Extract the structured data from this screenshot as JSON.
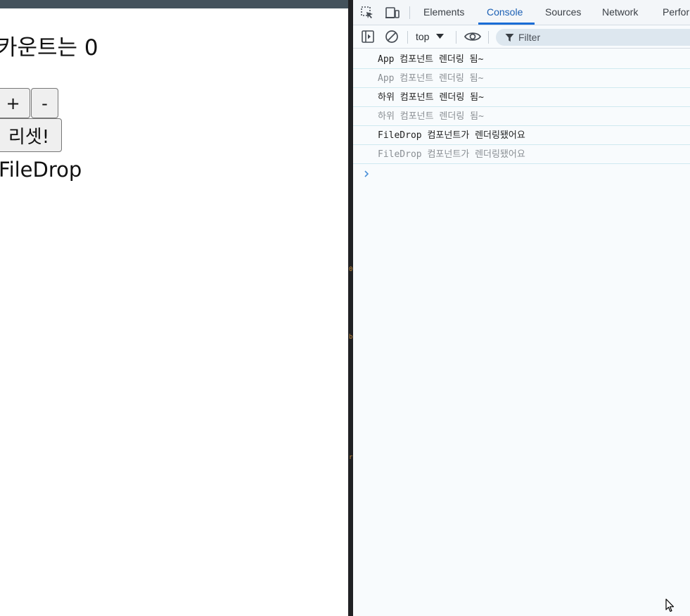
{
  "app": {
    "count_heading": "카운트는 0",
    "plus_label": "+",
    "minus_label": "-",
    "reset_label": "리셋!",
    "filedrop_text": "FileDrop"
  },
  "divider_marks": [
    "0",
    "b",
    "r"
  ],
  "devtools": {
    "tabs": [
      {
        "label": "Elements",
        "active": false
      },
      {
        "label": "Console",
        "active": true
      },
      {
        "label": "Sources",
        "active": false
      },
      {
        "label": "Network",
        "active": false
      },
      {
        "label": "Perfor",
        "active": false
      }
    ],
    "context": "top",
    "filter_placeholder": "Filter",
    "logs": [
      {
        "text": "App 컴포넌트 렌더링 됨~",
        "dim": false
      },
      {
        "text": "App 컴포넌트 렌더링 됨~",
        "dim": true
      },
      {
        "text": "하위 컴포넌트 렌더링 됨~",
        "dim": false
      },
      {
        "text": "하위 컴포넌트 렌더링 됨~",
        "dim": true
      },
      {
        "text": "FileDrop 컴포넌트가 렌더링됐어요",
        "dim": false
      },
      {
        "text": "FileDrop 컴포넌트가 렌더링됐어요",
        "dim": true
      }
    ]
  },
  "colors": {
    "active_tab": "#1a5fb4",
    "tab_underline": "#1a6dd6",
    "prompt_chevron": "#4a90d9"
  },
  "icons": [
    "inspect-element-icon",
    "device-toolbar-icon",
    "sidebar-toggle-icon",
    "clear-console-icon",
    "dropdown-arrow-icon",
    "live-expression-eye-icon",
    "filter-funnel-icon",
    "prompt-chevron-icon",
    "mouse-cursor-icon"
  ]
}
